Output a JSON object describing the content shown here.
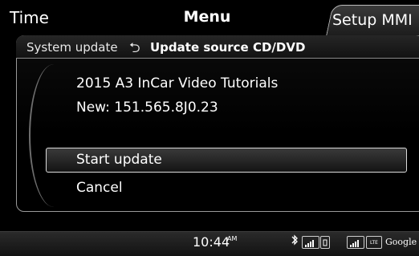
{
  "top_tabs": {
    "left": "Time",
    "center": "Menu",
    "active": "Setup MMI"
  },
  "header": {
    "parent": "System update",
    "back_symbol": "⮌",
    "current": "Update source CD/DVD"
  },
  "info": {
    "title": "2015 A3 InCar Video Tutorials",
    "version": "New: 151.565.8J0.23"
  },
  "options": [
    {
      "label": "Start update",
      "selected": true
    },
    {
      "label": "Cancel",
      "selected": false
    }
  ],
  "status": {
    "time": "10:44",
    "ampm": "AM",
    "lte": "LTE",
    "google": "Google"
  }
}
